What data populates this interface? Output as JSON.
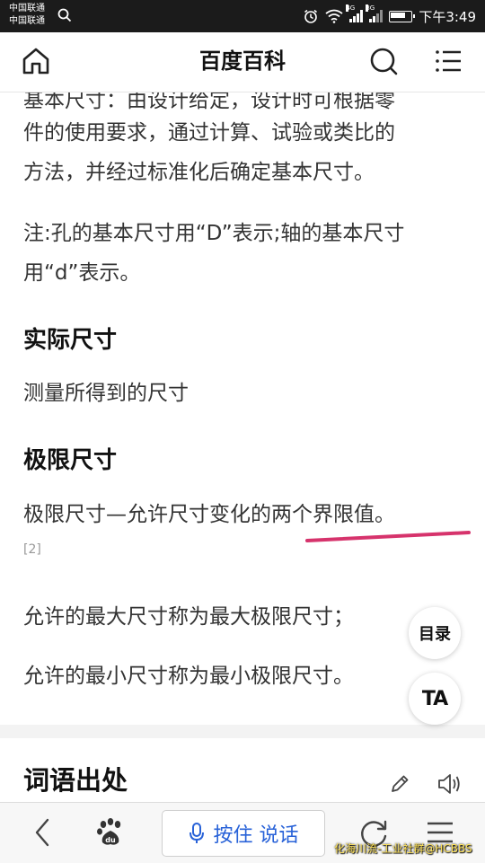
{
  "status_bar": {
    "carrier1": "中国联通",
    "carrier2": "中国联通",
    "net1": "4G",
    "net2": "3G",
    "time": "下午3:49"
  },
  "header": {
    "title": "百度百科",
    "home_icon": "home-icon",
    "search_icon": "search-icon",
    "menu_icon": "menu-icon"
  },
  "article": {
    "partial_line": "基本尺寸：由设计给定，设计时可根据零",
    "para1_line2": "件的使用要求，通过计算、试验或类比的",
    "para1_line3": "方法，并经过标准化后确定基本尺寸。",
    "note_line1": "注:孔的基本尺寸用“D”表示;轴的基本尺寸",
    "note_line2": "用“d”表示。",
    "heading_actual": "实际尺寸",
    "actual_text": "测量所得到的尺寸",
    "heading_limit": "极限尺寸",
    "limit_text": "极限尺寸—允许尺寸变化的两个界限值。",
    "ref": "[2]",
    "max_text": "允许的最大尺寸称为最大极限尺寸；",
    "min_text": "允许的最小尺寸称为最小极限尺寸。",
    "underline_color": "#d6336c"
  },
  "floating": {
    "toc_label": "目录",
    "font_label": "TA"
  },
  "section2": {
    "title": "词语出处",
    "edit_icon": "pencil-icon",
    "audio_icon": "speaker-icon"
  },
  "bottom_bar": {
    "back_icon": "chevron-left-icon",
    "baidu_icon": "baidu-paw-icon",
    "voice_label": "按住 说话",
    "mic_icon": "microphone-icon",
    "refresh_icon": "refresh-icon",
    "menu_icon": "menu-icon",
    "watermark": "化海川流-工业社群@HCBBS"
  },
  "colors": {
    "accent_blue": "#2862d8",
    "status_bar_bg": "#1b1b1b"
  }
}
